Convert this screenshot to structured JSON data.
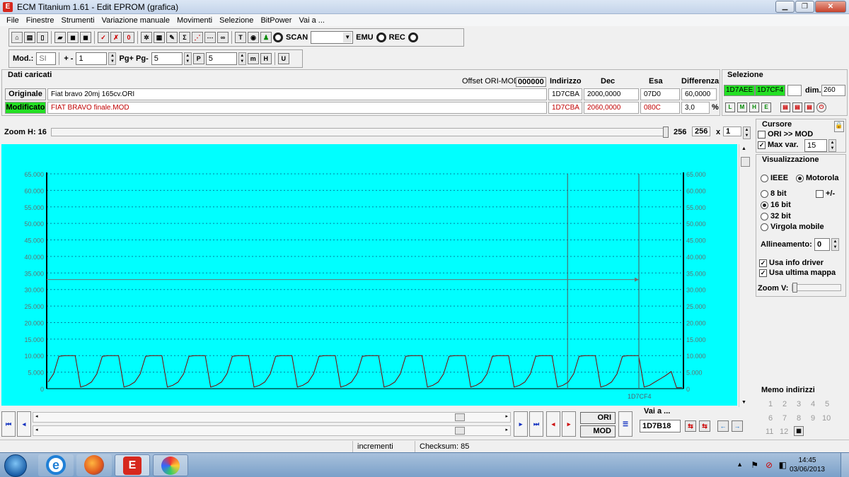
{
  "window": {
    "title": "ECM Titanium 1.61 - Edit EPROM (grafica)"
  },
  "menu": [
    "File",
    "Finestre",
    "Strumenti",
    "Variazione manuale",
    "Movimenti",
    "Selezione",
    "BitPower",
    "Vai a ..."
  ],
  "toolbar1": {
    "scan_label": "SCAN",
    "emu_label": "EMU",
    "rec_label": "REC"
  },
  "toolbar2": {
    "mod_label": "Mod.:",
    "mod_value": "SI",
    "plusminus_label": "+ -",
    "plusminus_value": "1",
    "pg_label": "Pg+ Pg-",
    "pg_value": "5",
    "p_value": "5"
  },
  "dati": {
    "title": "Dati caricati",
    "offset_label": "Offset ORI-MOD",
    "offset_value": "000000",
    "headers": {
      "indirizzo": "Indirizzo",
      "dec": "Dec",
      "esa": "Esa",
      "differenza": "Differenza"
    },
    "originale": {
      "label": "Originale",
      "file": "Fiat bravo 20mj 165cv.ORI",
      "indirizzo": "1D7CBA",
      "dec": "2000,0000",
      "esa": "07D0",
      "differenza": "60,0000"
    },
    "modificato": {
      "label": "Modificato",
      "file": "FIAT BRAVO finale.MOD",
      "indirizzo": "1D7CBA",
      "dec": "2060,0000",
      "esa": "080C",
      "differenza": "3,0",
      "unit": "%"
    }
  },
  "selezione": {
    "title": "Selezione",
    "start": "1D7AEE",
    "end": "1D7CF4",
    "dim_label": "dim.",
    "dim_value": "260"
  },
  "zoom": {
    "label": "Zoom H: 16",
    "value1": "256",
    "value2": "256",
    "mult_label": "x",
    "mult_value": "1"
  },
  "cursore": {
    "title": "Cursore",
    "ori_mod_label": "ORI >> MOD",
    "ori_mod_checked": false,
    "maxvar_label": "Max var.",
    "maxvar_checked": true,
    "maxvar_value": "15"
  },
  "visualizzazione": {
    "title": "Visualizzazione",
    "ieee": "IEEE",
    "motorola": "Motorola",
    "byteorder": "Motorola",
    "bit8": "8 bit",
    "bit16": "16 bit",
    "bit32": "32 bit",
    "virgola": "Virgola mobile",
    "selected_bits": "16 bit",
    "plusminus": "+/-",
    "allineamento_label": "Allineamento:",
    "allineamento_value": "0",
    "usa_info_driver": "Usa info driver",
    "usa_ultima_mappa": "Usa ultima mappa",
    "zoomv_label": "Zoom V:"
  },
  "chart_data": {
    "type": "line",
    "title": "",
    "xlabel": "",
    "ylabel": "",
    "ylim": [
      0,
      65000
    ],
    "yticks": [
      "0",
      "5.000",
      "10.000",
      "15.000",
      "20.000",
      "25.000",
      "30.000",
      "35.000",
      "40.000",
      "45.000",
      "50.000",
      "55.000",
      "60.000",
      "65.000"
    ],
    "grid": true,
    "cursor_label": "1D7CF4",
    "series": [
      {
        "color": "#800000",
        "values": [
          2000,
          4500,
          9800,
          10000,
          10000,
          10000,
          500,
          1000,
          2000,
          4500,
          9800,
          10000,
          10000,
          10000,
          500,
          1000,
          2000,
          4500,
          9800,
          10000,
          10000,
          10000,
          500,
          1000,
          2000,
          4500,
          9800,
          10000,
          10000,
          10000,
          500,
          1000,
          2000,
          4500,
          9800,
          10000,
          10000,
          10000,
          500,
          1000,
          2000,
          4500,
          9800,
          10000,
          10000,
          10000,
          500,
          1000,
          2000,
          4500,
          9800,
          10000,
          10000,
          10000,
          500,
          1000,
          2000,
          4500,
          9800,
          10000,
          10000,
          10000,
          500,
          1000,
          2000,
          4500,
          9800,
          10000,
          10000,
          10000,
          500,
          1000,
          2000,
          4500,
          9800,
          10000,
          10000,
          10000,
          500,
          1000,
          2000,
          4500,
          9800,
          10000,
          10000,
          10000,
          500,
          1000,
          2000,
          4500,
          9800,
          10000,
          10000,
          10000,
          500,
          1000,
          2000,
          4500,
          9800,
          10000,
          10000,
          10000,
          500,
          1000,
          2000,
          4500,
          9800,
          10000,
          10000,
          10000,
          500,
          1000,
          2000,
          3000,
          4000,
          5200,
          300,
          300
        ]
      }
    ]
  },
  "bottom": {
    "ori_label": "ORI",
    "mod_label": "MOD",
    "vai_title": "Vai a ...",
    "vai_value": "1D7B18"
  },
  "memo": {
    "title": "Memo indirizzi",
    "numbers": [
      "1",
      "2",
      "3",
      "4",
      "5",
      "6",
      "7",
      "8",
      "9",
      "10",
      "11",
      "12"
    ]
  },
  "status": {
    "incrementi": "incrementi",
    "checksum": "Checksum: 85"
  },
  "taskbar": {
    "time": "14:45",
    "date": "03/06/2013"
  },
  "colors": {
    "chart_bg": "#00ffff",
    "modified_green": "#24e024",
    "sel_green": "#24e024"
  }
}
